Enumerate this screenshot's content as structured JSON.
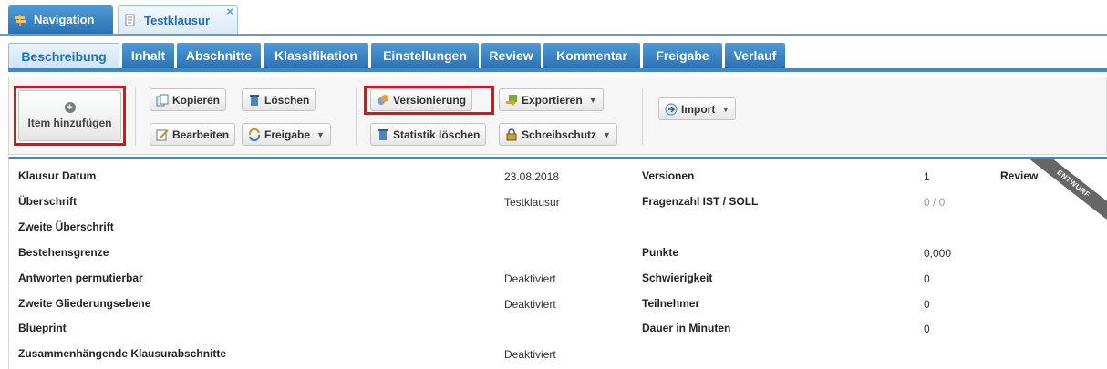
{
  "window_tabs": {
    "navigation": "Navigation",
    "test": "Testklausur",
    "close": "×"
  },
  "sub_tabs": [
    "Beschreibung",
    "Inhalt",
    "Abschnitte",
    "Klassifikation",
    "Einstellungen",
    "Review",
    "Kommentar",
    "Freigabe",
    "Verlauf"
  ],
  "active_sub_tab": "Beschreibung",
  "toolbar": {
    "add_item": "Item hinzufügen",
    "copy": "Kopieren",
    "delete": "Löschen",
    "edit": "Bearbeiten",
    "release": "Freigabe",
    "versioning": "Versionierung",
    "export": "Exportieren",
    "delete_stats": "Statistik löschen",
    "write_protect": "Schreibschutz",
    "import": "Import"
  },
  "highlight_color": "#e0101c",
  "accent_color": "#3b8ad0",
  "details_left": [
    {
      "label": "Klausur Datum",
      "value": "23.08.2018"
    },
    {
      "label": "Überschrift",
      "value": "Testklausur"
    },
    {
      "label": "Zweite Überschrift",
      "value": ""
    },
    {
      "label": "Bestehensgrenze",
      "value": ""
    },
    {
      "label": "Antworten permutierbar",
      "value": "Deaktiviert"
    },
    {
      "label": "Zweite Gliederungsebene",
      "value": "Deaktiviert"
    },
    {
      "label": "Blueprint",
      "value": ""
    },
    {
      "label": "Zusammenhängende Klausurabschnitte",
      "value": "Deaktiviert"
    }
  ],
  "details_right": [
    {
      "label": "Versionen",
      "value": "1"
    },
    {
      "label": "Fragenzahl IST / SOLL",
      "value": "0 / 0"
    },
    {
      "label": "",
      "value": ""
    },
    {
      "label": "Punkte",
      "value": "0,000"
    },
    {
      "label": "Schwierigkeit",
      "value": "0"
    },
    {
      "label": "Teilnehmer",
      "value": "0"
    },
    {
      "label": "Dauer in Minuten",
      "value": "0"
    }
  ],
  "review_label": "Review",
  "status_ribbon": "ENTWURF"
}
